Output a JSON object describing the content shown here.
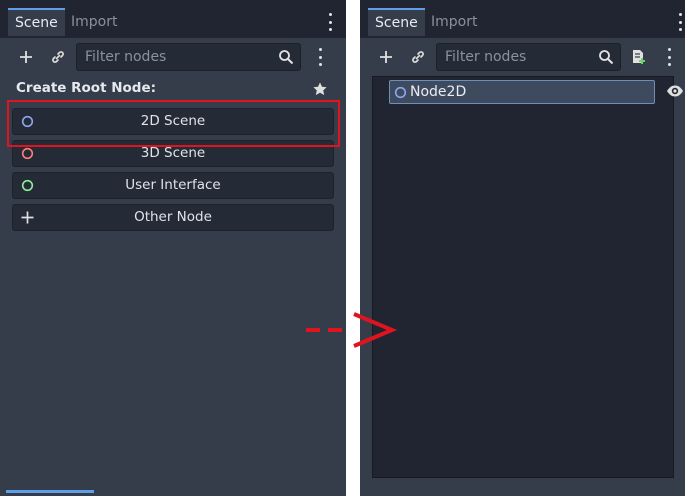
{
  "left": {
    "tabs": [
      {
        "label": "Scene"
      },
      {
        "label": "Import"
      }
    ],
    "filter_placeholder": "Filter nodes",
    "heading": "Create Root Node:",
    "nodes": [
      {
        "label": "2D Scene",
        "color": "#8da5f3",
        "icon": "node2d-circle-icon"
      },
      {
        "label": "3D Scene",
        "color": "#fc7f7f",
        "icon": "node3d-circle-icon"
      },
      {
        "label": "User Interface",
        "color": "#8eef97",
        "icon": "control-circle-icon"
      },
      {
        "label": "Other Node",
        "color": "#e0e0e0",
        "icon": "plus-icon"
      }
    ]
  },
  "right": {
    "tabs": [
      {
        "label": "Scene"
      },
      {
        "label": "Import"
      }
    ],
    "filter_placeholder": "Filter nodes",
    "tree": [
      {
        "label": "Node2D",
        "color": "#8da5f3",
        "icon": "node2d-circle-icon"
      }
    ]
  },
  "colors": {
    "accent": "#5f9fe8",
    "highlight": "#e0141e",
    "panel": "#363d4a",
    "background": "#202531"
  }
}
